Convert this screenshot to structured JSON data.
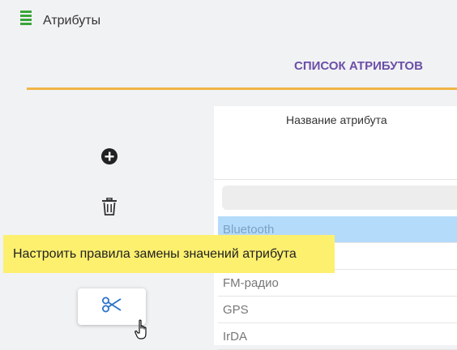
{
  "window": {
    "title": "Атрибуты",
    "title_icon": "list-lines-icon"
  },
  "header": {
    "tab_label": "СПИСОК АТРИБУТОВ",
    "accent_color": "#6b4fa8",
    "underline_color": "#f0b445"
  },
  "toolbar": {
    "add_icon": "plus-circle-icon",
    "delete_icon": "trash-icon",
    "replace_rules_icon": "scissors-icon"
  },
  "tooltip": {
    "text": "Настроить правила замены значений атрибута"
  },
  "table": {
    "column_header": "Название атрибута",
    "filter_value": "",
    "rows": [
      {
        "label": "Bluetooth",
        "selected": true
      },
      {
        "label": "",
        "selected": false
      },
      {
        "label": "FM-радио",
        "selected": false
      },
      {
        "label": "GPS",
        "selected": false
      },
      {
        "label": "IrDA",
        "selected": false
      }
    ]
  }
}
